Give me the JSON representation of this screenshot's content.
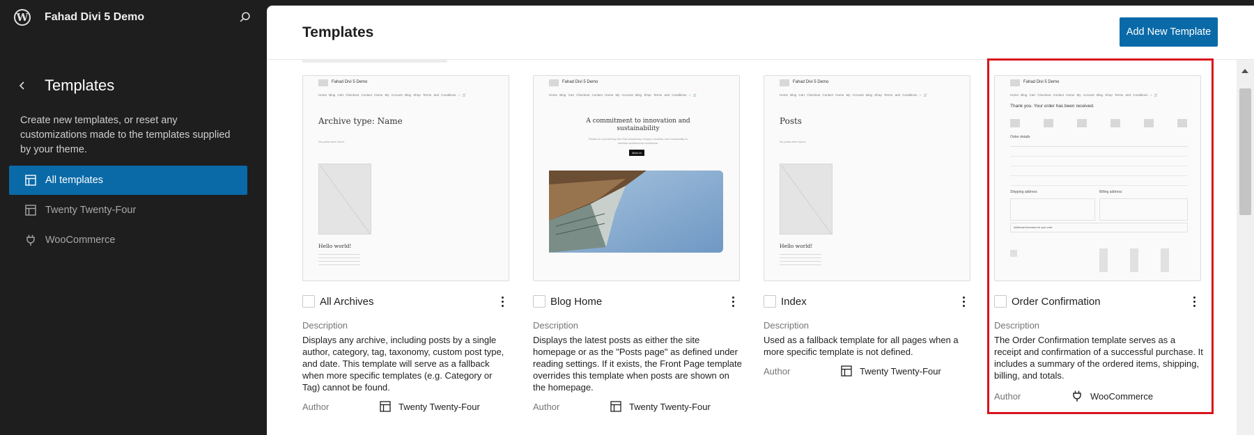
{
  "site": {
    "name": "Fahad Divi 5 Demo"
  },
  "sidebar": {
    "title": "Templates",
    "description": "Create new templates, or reset any customizations made to the templates supplied by your theme.",
    "items": [
      {
        "label": "All templates",
        "icon": "layout-icon",
        "active": true
      },
      {
        "label": "Twenty Twenty-Four",
        "icon": "layout-icon",
        "active": false
      },
      {
        "label": "WooCommerce",
        "icon": "plug-icon",
        "active": false
      }
    ]
  },
  "header": {
    "title": "Templates",
    "add_button": "Add New Template"
  },
  "preview": {
    "site": "Fahad Divi 5 Demo",
    "nav": "Home  Blog  Cart  Checkout  Contact  Home  My Account  Blog  Shop  Terms and Conditions  ⌂  🛒",
    "archive_heading": "Archive type: Name",
    "no_posts": "No posts were found.",
    "hello": "Hello world!",
    "hero_heading": "A commitment to innovation and sustainability",
    "hero_sub": "Études is a pioneering firm that seamlessly merges creativity and functionality to redefine architectural excellence.",
    "hero_button": "About us",
    "posts_heading": "Posts",
    "order_heading": "Thank you. Your order has been received.",
    "order_details": "Order details",
    "shipping_address": "Shipping address",
    "billing_address": "Billing address",
    "additional_info": "Additional information for your order"
  },
  "cards": [
    {
      "title": "All Archives",
      "description_label": "Description",
      "description": "Displays any archive, including posts by a single author, category, tag, taxonomy, custom post type, and date. This template will serve as a fallback when more specific templates (e.g. Category or Tag) cannot be found.",
      "author_label": "Author",
      "author": "Twenty Twenty-Four",
      "author_icon": "layout-icon"
    },
    {
      "title": "Blog Home",
      "description_label": "Description",
      "description": "Displays the latest posts as either the site homepage or as the \"Posts page\" as defined under reading settings. If it exists, the Front Page template overrides this template when posts are shown on the homepage.",
      "author_label": "Author",
      "author": "Twenty Twenty-Four",
      "author_icon": "layout-icon"
    },
    {
      "title": "Index",
      "description_label": "Description",
      "description": "Used as a fallback template for all pages when a more specific template is not defined.",
      "author_label": "Author",
      "author": "Twenty Twenty-Four",
      "author_icon": "layout-icon"
    },
    {
      "title": "Order Confirmation",
      "description_label": "Description",
      "description": "The Order Confirmation template serves as a receipt and confirmation of a successful purchase. It includes a summary of the ordered items, shipping, billing, and totals.",
      "author_label": "Author",
      "author": "WooCommerce",
      "author_icon": "plug-icon"
    }
  ],
  "colors": {
    "accent": "#0a6aa8",
    "highlight": "#d9121b",
    "sidebar_bg": "#1e1e1e"
  }
}
